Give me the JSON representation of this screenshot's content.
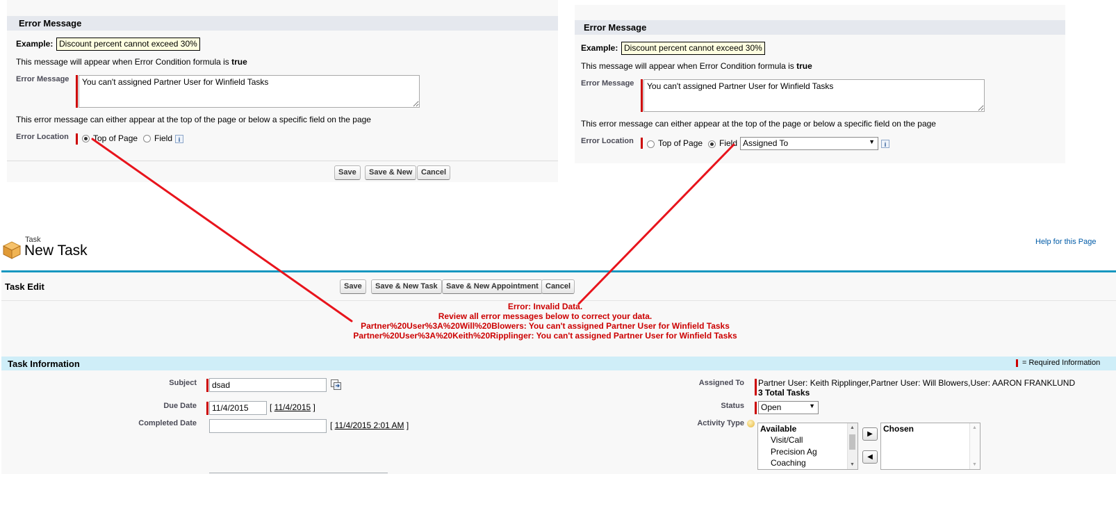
{
  "left_panel": {
    "section_title": "Error Message",
    "example_label": "Example:",
    "example_text": "Discount percent cannot exceed 30%",
    "hint_prefix": "This message will appear when Error Condition formula is ",
    "hint_bold": "true",
    "error_message_label": "Error Message",
    "error_message_value": "You can't assigned Partner User for Winfield Tasks",
    "location_hint": "This error message can either appear at the top of the page or below a specific field on the page",
    "error_location_label": "Error Location",
    "option_top": "Top of Page",
    "option_field": "Field",
    "info_icon": "i",
    "buttons": {
      "save": "Save",
      "save_new": "Save & New",
      "cancel": "Cancel"
    }
  },
  "right_panel": {
    "section_title": "Error Message",
    "example_label": "Example:",
    "example_text": "Discount percent cannot exceed 30%",
    "hint_prefix": "This message will appear when Error Condition formula is ",
    "hint_bold": "true",
    "error_message_label": "Error Message",
    "error_message_value": "You can't assigned Partner User for Winfield Tasks",
    "location_hint": "This error message can either appear at the top of the page or below a specific field on the page",
    "error_location_label": "Error Location",
    "option_top": "Top of Page",
    "option_field": "Field",
    "field_select_value": "Assigned To",
    "info_icon": "i"
  },
  "task_page": {
    "object_label": "Task",
    "page_title": "New Task",
    "help_link": "Help for this Page",
    "edit_title": "Task Edit",
    "buttons": {
      "save": "Save",
      "save_new_task": "Save & New Task",
      "save_new_appointment": "Save & New Appointment",
      "cancel": "Cancel"
    },
    "errors": [
      "Error: Invalid Data.",
      "Review all error messages below to correct your data.",
      "Partner%20User%3A%20Will%20Blowers: You can't assigned Partner User for Winfield Tasks",
      "Partner%20User%3A%20Keith%20Ripplinger: You can't assigned Partner User for Winfield Tasks"
    ],
    "section_title": "Task Information",
    "required_info": "= Required Information",
    "fields": {
      "subject_label": "Subject",
      "subject_value": "dsad",
      "due_date_label": "Due Date",
      "due_date_value": "11/4/2015",
      "due_date_link": "11/4/2015",
      "completed_label": "Completed Date",
      "completed_value": "",
      "completed_link": "11/4/2015 2:01 AM",
      "assigned_label": "Assigned To",
      "assigned_value": "Partner User: Keith Ripplinger,Partner User: Will Blowers,User: AARON FRANKLUND",
      "assigned_total": "3 Total Tasks",
      "status_label": "Status",
      "status_value": "Open",
      "activity_label": "Activity Type",
      "available_header": "Available",
      "available_items": [
        "Visit/Call",
        "Precision Ag",
        "Coaching"
      ],
      "chosen_header": "Chosen"
    }
  },
  "colors": {
    "required": "#cc0000",
    "error_text": "#cc0000",
    "section_blue": "#cfeef8",
    "header_rule": "#1797c0",
    "annotation_arrow": "#e8141c"
  }
}
